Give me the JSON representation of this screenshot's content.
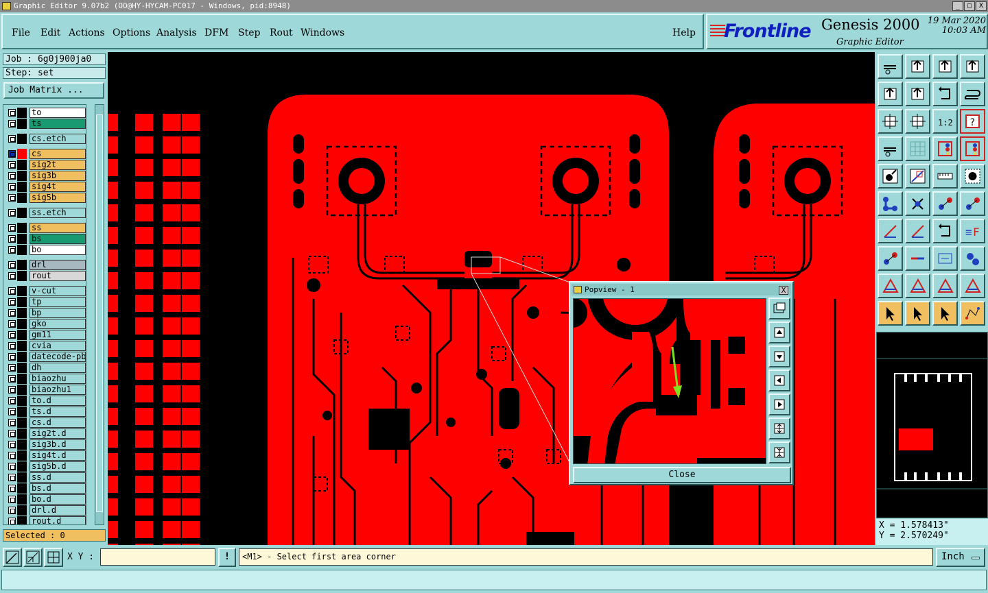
{
  "window": {
    "title": "Graphic Editor 9.07b2 (OO@HY-HYCAM-PC017 - Windows, pid:8948)",
    "minimize": "_",
    "maximize": "□",
    "close": "X"
  },
  "menu": {
    "file": "File",
    "edit": "Edit",
    "actions": "Actions",
    "options": "Options",
    "analysis": "Analysis",
    "dfm": "DFM",
    "step": "Step",
    "rout": "Rout",
    "windows": "Windows",
    "help": "Help"
  },
  "brand": {
    "logo": "Frontline",
    "product": "Genesis 2000",
    "subtitle": "Graphic Editor",
    "date": "19 Mar 2020",
    "time": "10:03 AM"
  },
  "job": {
    "job_label": "Job : 6g0j900ja0",
    "step_label": "Step: set",
    "matrix_button": "Job Matrix ..."
  },
  "layers": [
    {
      "name": "to",
      "color": "#ffffff",
      "swatch": "#000000"
    },
    {
      "name": "ts",
      "color": "#1a9a70",
      "swatch": "#000000"
    },
    {
      "name": "cs.etch",
      "color": "#9ed8d8",
      "swatch": "#000000"
    },
    {
      "name": "cs",
      "color": "#f0c060",
      "swatch": "#ff0000",
      "active": true
    },
    {
      "name": "sig2t",
      "color": "#f0c060",
      "swatch": "#000000"
    },
    {
      "name": "sig3b",
      "color": "#f0c060",
      "swatch": "#000000"
    },
    {
      "name": "sig4t",
      "color": "#f0c060",
      "swatch": "#000000"
    },
    {
      "name": "sig5b",
      "color": "#f0c060",
      "swatch": "#000000"
    },
    {
      "name": "ss.etch",
      "color": "#9ed8d8",
      "swatch": "#000000"
    },
    {
      "name": "ss",
      "color": "#f0c060",
      "swatch": "#000000"
    },
    {
      "name": "bs",
      "color": "#1a9a70",
      "swatch": "#000000"
    },
    {
      "name": "bo",
      "color": "#ffffff",
      "swatch": "#000000"
    },
    {
      "name": "drl",
      "color": "#a8b8c0",
      "swatch": "#000000"
    },
    {
      "name": "rout",
      "color": "#d8d8d8",
      "swatch": "#000000"
    },
    {
      "name": "v-cut",
      "color": "#9ed8d8",
      "swatch": "#000000"
    },
    {
      "name": "tp",
      "color": "#9ed8d8",
      "swatch": "#000000"
    },
    {
      "name": "bp",
      "color": "#9ed8d8",
      "swatch": "#000000"
    },
    {
      "name": "gko",
      "color": "#9ed8d8",
      "swatch": "#000000"
    },
    {
      "name": "gm11",
      "color": "#9ed8d8",
      "swatch": "#000000"
    },
    {
      "name": "cvia",
      "color": "#9ed8d8",
      "swatch": "#000000"
    },
    {
      "name": "datecode-pbo",
      "color": "#9ed8d8",
      "swatch": "#000000"
    },
    {
      "name": "dh",
      "color": "#9ed8d8",
      "swatch": "#000000"
    },
    {
      "name": "biaozhu",
      "color": "#9ed8d8",
      "swatch": "#000000"
    },
    {
      "name": "biaozhu1",
      "color": "#9ed8d8",
      "swatch": "#000000"
    },
    {
      "name": "to.d",
      "color": "#9ed8d8",
      "swatch": "#000000"
    },
    {
      "name": "ts.d",
      "color": "#9ed8d8",
      "swatch": "#000000"
    },
    {
      "name": "cs.d",
      "color": "#9ed8d8",
      "swatch": "#000000"
    },
    {
      "name": "sig2t.d",
      "color": "#9ed8d8",
      "swatch": "#000000"
    },
    {
      "name": "sig3b.d",
      "color": "#9ed8d8",
      "swatch": "#000000"
    },
    {
      "name": "sig4t.d",
      "color": "#9ed8d8",
      "swatch": "#000000"
    },
    {
      "name": "sig5b.d",
      "color": "#9ed8d8",
      "swatch": "#000000"
    },
    {
      "name": "ss.d",
      "color": "#9ed8d8",
      "swatch": "#000000"
    },
    {
      "name": "bs.d",
      "color": "#9ed8d8",
      "swatch": "#000000"
    },
    {
      "name": "bo.d",
      "color": "#9ed8d8",
      "swatch": "#000000"
    },
    {
      "name": "drl.d",
      "color": "#9ed8d8",
      "swatch": "#000000"
    },
    {
      "name": "rout.d",
      "color": "#9ed8d8",
      "swatch": "#000000"
    }
  ],
  "selected": "Selected : 0",
  "popview": {
    "title": "Popview - 1",
    "close_x": "X",
    "close_button": "Close"
  },
  "coords": {
    "x": "X = 1.578413\"",
    "y": "Y = 2.570249\""
  },
  "bottom": {
    "xy_label": "X Y :",
    "xy_value": "",
    "bang": "!",
    "status": "<M1> - Select first area corner",
    "units": "Inch"
  },
  "colors": {
    "panel": "#9ed8d8",
    "copper": "#ff0000",
    "background": "#000000",
    "highlight_arrow": "#7ee020"
  }
}
